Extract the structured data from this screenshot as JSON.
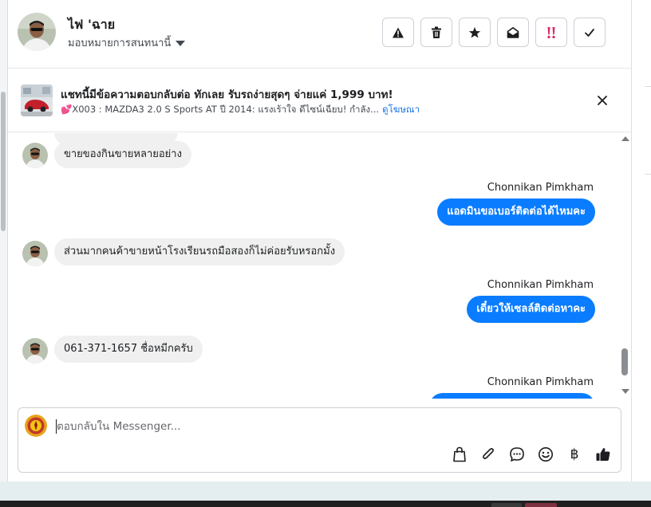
{
  "conversation": {
    "contact_name": "ไฟ 'ฉาย",
    "assign_label": "มอบหมายการสนทนานี้"
  },
  "header_actions": [
    {
      "name": "spam-button",
      "icon": "warning-icon"
    },
    {
      "name": "delete-button",
      "icon": "trash-icon"
    },
    {
      "name": "star-button",
      "icon": "star-icon"
    },
    {
      "name": "mark-unread-button",
      "icon": "envelope-open-icon"
    },
    {
      "name": "follow-up-button",
      "icon": "double-exclamation-icon"
    },
    {
      "name": "mark-done-button",
      "icon": "check-icon"
    }
  ],
  "ad": {
    "title": "แชทนี้มีข้อความตอบกลับต่อ ทักเลย รับรถง่ายสุดๆ จ่ายแค่ 1,999 บาท!",
    "subtitle": "💕X003 : MAZDA3 2.0 S Sports AT ปี 2014: แรงเร้าใจ ดีไซน์เฉียบ! กำลัง...",
    "link_label": "ดูโฆษณา"
  },
  "messages": [
    {
      "direction": "in",
      "text": "ขายของกินขายหลายอย่าง"
    },
    {
      "direction": "out",
      "sender": "Chonnikan Pimkham",
      "text": "แอดมินขอเบอร์ติดต่อได้ไหมคะ"
    },
    {
      "direction": "in",
      "text": "ส่วนมากคนค้าขายหน้าโรงเรียนรถมือสองก็ไม่ค่อยรับหรอกมั้ง"
    },
    {
      "direction": "out",
      "sender": "Chonnikan Pimkham",
      "text": "เดี๋ยวให้เซลล์ติดต่อหาคะ"
    },
    {
      "direction": "in",
      "text": "061-371-1657 ชื่อหมีกครับ"
    },
    {
      "direction": "out",
      "sender": "Chonnikan Pimkham",
      "text": ""
    }
  ],
  "composer": {
    "placeholder": "ตอบกลับใน Messenger...",
    "tools": [
      "bag-icon",
      "paperclip-icon",
      "saved-reply-icon",
      "emoji-icon",
      "baht-icon",
      "thumbs-up-icon"
    ],
    "baht_symbol": "฿"
  },
  "colors": {
    "accent": "#0a7cff",
    "incoming_bubble": "#f0f0f0",
    "link": "#1b74e4"
  }
}
